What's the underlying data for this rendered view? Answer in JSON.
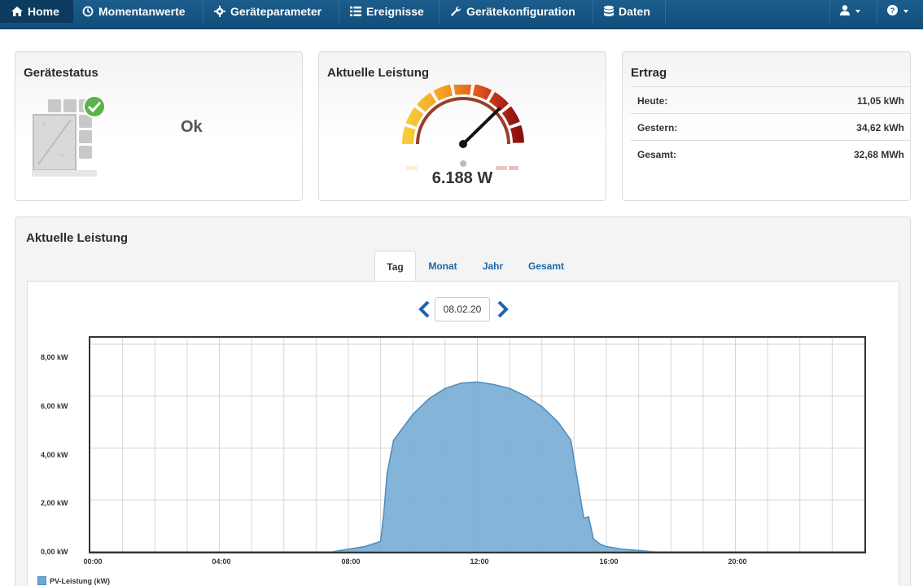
{
  "nav": {
    "items": [
      {
        "label": "Home",
        "icon": "home-icon"
      },
      {
        "label": "Momentanwerte",
        "icon": "clock-icon"
      },
      {
        "label": "Geräteparameter",
        "icon": "gear-icon"
      },
      {
        "label": "Ereignisse",
        "icon": "list-icon"
      },
      {
        "label": "Gerätekonfiguration",
        "icon": "wrench-icon"
      },
      {
        "label": "Daten",
        "icon": "database-icon"
      }
    ],
    "user_icon": "user-icon",
    "help_icon": "help-icon"
  },
  "status_panel": {
    "title": "Gerätestatus",
    "status": "Ok",
    "icon": "inverter-ok-icon"
  },
  "power_panel": {
    "title": "Aktuelle Leistung",
    "value": "6.188 W"
  },
  "ertrag_panel": {
    "title": "Ertrag",
    "rows": [
      {
        "label": "Heute:",
        "value": "11,05 kWh"
      },
      {
        "label": "Gestern:",
        "value": "34,62 kWh"
      },
      {
        "label": "Gesamt:",
        "value": "32,68 MWh"
      }
    ]
  },
  "chart_panel": {
    "title": "Aktuelle Leistung",
    "tabs": [
      "Tag",
      "Monat",
      "Jahr",
      "Gesamt"
    ],
    "active_tab": "Tag",
    "date": "08.02.20"
  },
  "colors": {
    "nav": "#1b5d8c",
    "accent": "#1d66a8",
    "area_fill": "#6ea8d1",
    "area_line": "#4f8cbb"
  },
  "chart_data": {
    "type": "area",
    "title": "",
    "xlabel": "",
    "ylabel": "",
    "x_tick_labels": [
      "00:00",
      "04:00",
      "08:00",
      "12:00",
      "16:00",
      "20:00"
    ],
    "y_tick_labels": [
      "0,00 kW",
      "2,00 kW",
      "4,00 kW",
      "6,00 kW",
      "8,00 kW"
    ],
    "xlim": [
      0,
      24
    ],
    "ylim": [
      0,
      8.25
    ],
    "grid": true,
    "legend": "bottom-left",
    "series": [
      {
        "name": "PV-Leistung (kW)",
        "x": [
          0,
          7.5,
          8,
          8.5,
          9,
          9.1,
          9.2,
          9.4,
          9.7,
          10,
          10.5,
          11,
          11.5,
          12,
          12.5,
          13,
          13.5,
          14,
          14.5,
          14.9,
          15.1,
          15.3,
          15.45,
          15.6,
          15.8,
          16,
          16.5,
          17,
          17.5,
          24
        ],
        "y": [
          0,
          0,
          0.1,
          0.2,
          0.4,
          1.5,
          3.0,
          4.3,
          4.8,
          5.3,
          5.9,
          6.3,
          6.5,
          6.55,
          6.45,
          6.3,
          6.0,
          5.6,
          5.0,
          4.3,
          2.8,
          1.3,
          1.35,
          0.5,
          0.3,
          0.2,
          0.1,
          0.05,
          0,
          0
        ]
      }
    ]
  }
}
